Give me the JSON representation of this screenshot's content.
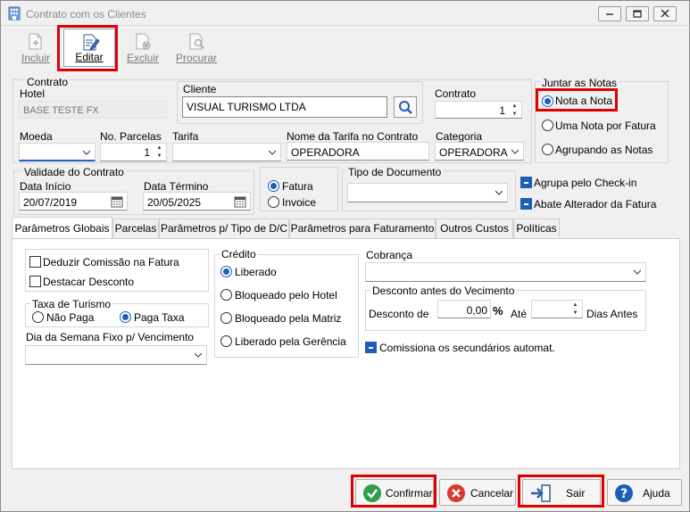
{
  "window": {
    "title": "Contrato com os Clientes"
  },
  "toolbar": {
    "incluir": "Incluir",
    "editar": "Editar",
    "excluir": "Excluir",
    "procurar": "Procurar"
  },
  "contrato_group": {
    "title": "Contrato",
    "hotel_label": "Hotel",
    "hotel_value": "BASE TESTE FX",
    "cliente_label": "Cliente",
    "cliente_value": "VISUAL TURISMO LTDA",
    "contrato_label": "Contrato",
    "contrato_value": "1",
    "moeda_label": "Moeda",
    "moeda_value": "",
    "parcelas_label": "No. Parcelas",
    "parcelas_value": "1",
    "tarifa_label": "Tarifa",
    "tarifa_value": "",
    "nome_tarifa_label": "Nome da Tarifa no Contrato",
    "nome_tarifa_value": "OPERADORA",
    "categoria_label": "Categoria",
    "categoria_value": "OPERADORA"
  },
  "juntar": {
    "title": "Juntar as Notas",
    "options": [
      "Nota a Nota",
      "Uma Nota por Fatura",
      "Agrupando as Notas"
    ],
    "selected": "Nota a Nota"
  },
  "validade": {
    "title": "Validade do Contrato",
    "inicio_label": "Data Início",
    "inicio_value": "20/07/2019",
    "termino_label": "Data Término",
    "termino_value": "20/05/2025"
  },
  "fatura_invoice": {
    "options": [
      "Fatura",
      "Invoice"
    ],
    "selected": "Fatura"
  },
  "tipo_documento": {
    "label": "Tipo de Documento",
    "value": ""
  },
  "flags": {
    "agrupa_checkin": "Agrupa pelo Check-in",
    "abate_alterador": "Abate Alterador da Fatura"
  },
  "tabs": [
    "Parâmetros Globais",
    "Parcelas",
    "Parâmetros p/ Tipo de D/C",
    "Parâmetros para Faturamento",
    "Outros Custos",
    "Políticas"
  ],
  "globais": {
    "deduzir_comissao": "Deduzir Comissão na Fatura",
    "destacar_desconto": "Destacar Desconto",
    "taxa_turismo_title": "Taxa de Turismo",
    "nao_paga": "Não Paga",
    "paga_taxa": "Paga Taxa",
    "dia_semana_label": "Dia da Semana Fixo p/ Vencimento",
    "dia_semana_value": "",
    "credito_title": "Crédito",
    "credito_options": [
      "Liberado",
      "Bloqueado pelo Hotel",
      "Bloqueado pela Matriz",
      "Liberado pela Gerência"
    ],
    "credito_selected": "Liberado",
    "cobranca_label": "Cobrança",
    "cobranca_value": "",
    "desconto_title": "Desconto antes do Vecimento",
    "desconto_de_label": "Desconto de",
    "desconto_value": "0,00",
    "percent": "%",
    "ate_label": "Até",
    "ate_value": "",
    "dias_antes": "Dias Antes",
    "comissiona": "Comissiona os secundários automat."
  },
  "buttons": {
    "confirmar": "Confirmar",
    "cancelar": "Cancelar",
    "sair": "Sair",
    "ajuda": "Ajuda"
  },
  "colors": {
    "accent": "#1e5eb8",
    "highlight": "#e00000"
  }
}
